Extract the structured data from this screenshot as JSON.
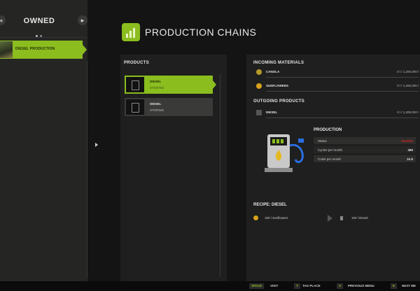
{
  "sidebar": {
    "title": "OWNED",
    "items": [
      {
        "label": "DIESEL PRODUCTION"
      }
    ]
  },
  "page": {
    "title": "PRODUCTION CHAINS"
  },
  "products_panel": {
    "title": "PRODUCTS",
    "items": [
      {
        "name": "DIESEL",
        "status": "STORING",
        "selected": true
      },
      {
        "name": "DIESEL",
        "status": "STORING",
        "selected": false
      }
    ]
  },
  "incoming": {
    "title": "INCOMING MATERIALS",
    "items": [
      {
        "name": "CANOLA",
        "value": "0 l / 1,200,000 l",
        "icon": "canola-icon"
      },
      {
        "name": "SUNFLOWERS",
        "value": "0 l / 1,200,000 l",
        "icon": "sunflower-icon"
      }
    ]
  },
  "outgoing": {
    "title": "OUTGOING PRODUCTS",
    "items": [
      {
        "name": "DIESEL",
        "value": "0 l / 1,200,000 l",
        "icon": "diesel-icon"
      }
    ]
  },
  "production": {
    "title": "PRODUCTION",
    "rows": [
      {
        "label": "Status",
        "value": "Inactive"
      },
      {
        "label": "Cycles per month",
        "value": "480"
      },
      {
        "label": "Costs per month",
        "value": "24 $"
      }
    ]
  },
  "recipe": {
    "title": "RECIPE: DIESEL",
    "input": "150 l Sunflowers",
    "output": "100 l Diesel"
  },
  "bottom_bar": {
    "hints": [
      {
        "key": "SPACE",
        "label": "VISIT"
      },
      {
        "key": "T",
        "label": "TAG PLACE"
      },
      {
        "key": "A",
        "label": "PREVIOUS MENU"
      },
      {
        "key": "E",
        "label": "NEXT ME"
      }
    ]
  },
  "colors": {
    "accent": "#8bbd1f",
    "status_inactive": "#dd2222"
  }
}
